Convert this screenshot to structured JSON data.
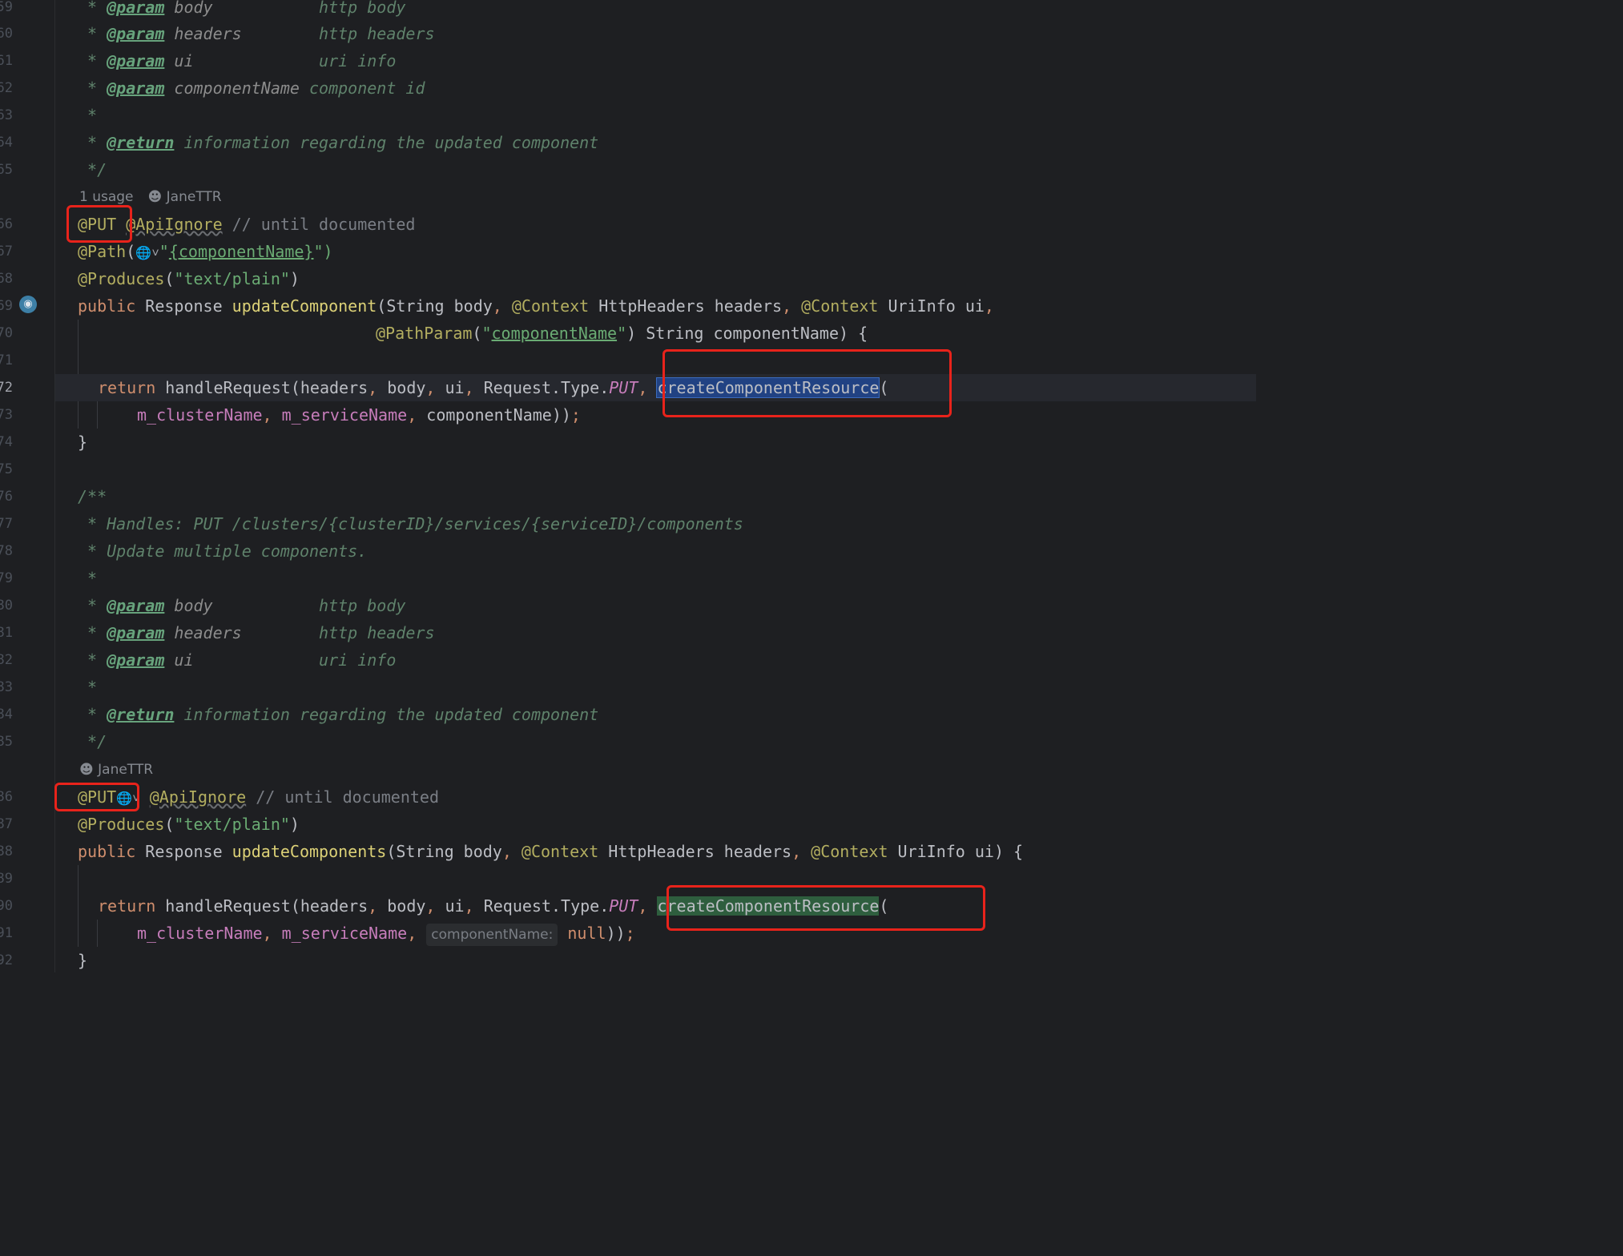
{
  "line_numbers": [
    "59",
    "60",
    "61",
    "62",
    "63",
    "64",
    "65",
    "66",
    "67",
    "68",
    "69",
    "70",
    "71",
    "72",
    "73",
    "74",
    "75",
    "76",
    "77",
    "78",
    "79",
    "80",
    "81",
    "82",
    "83",
    "84",
    "85",
    "86",
    "87",
    "88",
    "89",
    "90",
    "91",
    "92"
  ],
  "lines": {
    "l59": {
      "star": " * ",
      "tag": "@param",
      "pname": " body",
      "desc": "           http body"
    },
    "l60": {
      "star": " * ",
      "tag": "@param",
      "pname": " headers",
      "desc": "        http headers"
    },
    "l61": {
      "star": " * ",
      "tag": "@param",
      "pname": " ui",
      "desc": "             uri info"
    },
    "l62": {
      "star": " * ",
      "tag": "@param",
      "pname": " componentName",
      "desc": " component id"
    },
    "l63": {
      "star": " *"
    },
    "l64": {
      "star": " * ",
      "tag": "@return",
      "desc": " information regarding the updated component"
    },
    "l65": {
      "star": " */"
    },
    "meta1": {
      "usages": "1 usage",
      "author": "JaneTTR"
    },
    "l66": {
      "ann1": "@PUT",
      "ann2": "@ApiIgnore",
      "comment": " // until documented"
    },
    "l67": {
      "ann": "@Path",
      "open": "(",
      "q": "\"",
      "path": "{componentName}",
      "close": "\")"
    },
    "l68": {
      "ann": "@Produces",
      "open": "(",
      "str": "\"text/plain\"",
      "close": ")"
    },
    "l69": {
      "kw": "public",
      "type": " Response ",
      "fn": "updateComponent",
      "p1": "(String body",
      "c1": ", ",
      "a1": "@Context",
      "p2": " HttpHeaders headers",
      "c2": ", ",
      "a2": "@Context",
      "p3": " UriInfo ui",
      "c3": ","
    },
    "l70": {
      "ann": "@PathParam",
      "open": "(",
      "str1": "\"",
      "str2": "componentName",
      "str3": "\"",
      "rest": ") String componentName) {"
    },
    "l72": {
      "kw": "return",
      "call": " handleRequest(headers",
      "c1": ", ",
      "a1": "body",
      "c2": ", ",
      "a2": "ui",
      "c3": ", ",
      "a3": "Request.Type.",
      "const": "PUT",
      "c4": ", ",
      "sel": "createComponentResource",
      "open": "("
    },
    "l73": {
      "f1": "m_clusterName",
      "c1": ", ",
      "f2": "m_serviceName",
      "c2": ", ",
      "rest": "componentName))",
      "semi": ";"
    },
    "l74": {
      "brace": "}"
    },
    "l76": {
      "text": "/**"
    },
    "l77": {
      "text": " * Handles: PUT /clusters/{clusterID}/services/{serviceID}/components"
    },
    "l78": {
      "text": " * Update multiple components."
    },
    "l79": {
      "star": " *"
    },
    "l80": {
      "star": " * ",
      "tag": "@param",
      "pname": " body",
      "desc": "           http body"
    },
    "l81": {
      "star": " * ",
      "tag": "@param",
      "pname": " headers",
      "desc": "        http headers"
    },
    "l82": {
      "star": " * ",
      "tag": "@param",
      "pname": " ui",
      "desc": "             uri info"
    },
    "l83": {
      "star": " *"
    },
    "l84": {
      "star": " * ",
      "tag": "@return",
      "desc": " information regarding the updated component"
    },
    "l85": {
      "star": " */"
    },
    "meta2": {
      "author": "JaneTTR"
    },
    "l86": {
      "ann1": "@PUT",
      "ann2": "@ApiIgnore",
      "comment": " // until documented"
    },
    "l87": {
      "ann": "@Produces",
      "open": "(",
      "str": "\"text/plain\"",
      "close": ")"
    },
    "l88": {
      "kw": "public",
      "type": " Response ",
      "fn": "updateComponents",
      "p1": "(String body",
      "c1": ", ",
      "a1": "@Context",
      "p2": " HttpHeaders headers",
      "c2": ", ",
      "a2": "@Context",
      "p3": " UriInfo ui) {"
    },
    "l90": {
      "kw": "return",
      "call": " handleRequest(headers",
      "c1": ", ",
      "a1": "body",
      "c2": ", ",
      "a2": "ui",
      "c3": ", ",
      "a3": "Request.Type.",
      "const": "PUT",
      "c4": ", ",
      "occ": "createComponentResource",
      "open": "("
    },
    "l91": {
      "f1": "m_clusterName",
      "c1": ", ",
      "f2": "m_serviceName",
      "c2": ", ",
      "hint": "componentName:",
      "nul": " null",
      "rest": "))",
      "semi": ";"
    },
    "l92": {
      "brace": "}"
    }
  },
  "icons": {
    "person": "user-icon",
    "globe": "globe-icon",
    "gutter": "web-endpoint-icon"
  },
  "colors": {
    "background": "#1e1f22",
    "annotation": "#b3ae60",
    "keyword": "#cf8e6d",
    "comment": "#5f826b",
    "string": "#6aab73",
    "field": "#c77dbb",
    "selection": "#214283",
    "occurrence": "#2e5e3e",
    "callout": "#e8231b"
  }
}
